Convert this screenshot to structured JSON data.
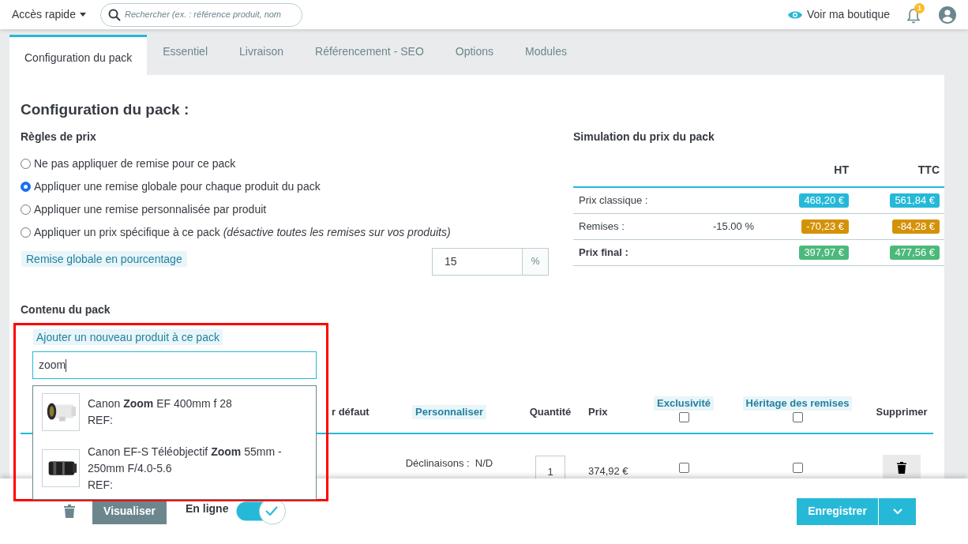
{
  "header": {
    "quick_access": "Accès rapide",
    "search": {
      "placeholder": "Rechercher (ex. : référence produit, nom"
    },
    "view_shop": "Voir ma boutique",
    "notifications": {
      "count": "1"
    }
  },
  "tabs": [
    {
      "label": "Configuration du pack",
      "selected": true
    },
    {
      "label": "Essentiel",
      "selected": false
    },
    {
      "label": "Livraison",
      "selected": false
    },
    {
      "label": "Référencement - SEO",
      "selected": false
    },
    {
      "label": "Options",
      "selected": false
    },
    {
      "label": "Modules",
      "selected": false
    }
  ],
  "pack_config": {
    "title": "Configuration du pack :",
    "pricing_rules": {
      "title": "Règles de prix",
      "options": [
        {
          "label": "Ne pas appliquer de remise pour ce pack",
          "selected": false
        },
        {
          "label": "Appliquer une remise globale pour chaque produit du pack",
          "selected": true
        },
        {
          "label": "Appliquer une remise personnalisée par produit",
          "selected": false
        },
        {
          "label": "Appliquer un prix spécifique à ce pack *(désactive toutes les remises sur vos produits)*",
          "selected": false
        }
      ]
    },
    "global_discount": {
      "label": "Remise globale en pourcentage",
      "value": "15",
      "unit": "%"
    }
  },
  "simulation": {
    "title": "Simulation du prix du pack",
    "columns": [
      "HT",
      "TTC"
    ],
    "rows": [
      {
        "kind": "regular",
        "label": "Prix classique :",
        "ht": "468,20 €",
        "ttc": "561,84 €",
        "color": "#25b9d7"
      },
      {
        "kind": "regular",
        "label": "Remises :",
        "discount": "-15.00 %",
        "ht": "-70,23 €",
        "ttc": "-84,28 €",
        "color": "#d49208"
      },
      {
        "kind": "total",
        "label": "Prix final :",
        "ht": "397,97 €",
        "ttc": "477,56 €",
        "color": "#4cb97a"
      }
    ]
  },
  "pack_content": {
    "title": "Contenu du pack",
    "add_label": "Ajouter un nouveau produit à ce pack",
    "search": {
      "value": "zoom"
    },
    "suggestions": [
      {
        "name": "Canon **Zoom** EF 400mm f 28",
        "ref": "REF:",
        "kind": "white-lens"
      },
      {
        "name": "Canon EF-S Téléobjectif **Zoom** 55mm - 250mm F/4.0-5.6",
        "ref": "REF:",
        "kind": "black-lens"
      }
    ],
    "columns": [
      {
        "label": "r défaut",
        "kind": "plain"
      },
      {
        "label": "Personnaliser",
        "kind": "badge"
      },
      {
        "label": "Quantité",
        "kind": "plain"
      },
      {
        "label": "Prix",
        "kind": "plain"
      },
      {
        "label": "Exclusivité",
        "kind": "badge-checkbox",
        "checked": false
      },
      {
        "label": "Héritage des remises",
        "kind": "badge-checkbox",
        "checked": false
      },
      {
        "label": "Supprimer",
        "kind": "plain"
      }
    ],
    "rows": [
      {
        "variants": "Déclinaisons :  N/D",
        "quantity": "1",
        "price": "374,92 €",
        "exclusive": false,
        "inherit_discounts": false
      }
    ]
  },
  "footer": {
    "visualize": "Visualiser",
    "online": {
      "label": "En ligne",
      "on": true
    },
    "save": "Enregistrer"
  }
}
